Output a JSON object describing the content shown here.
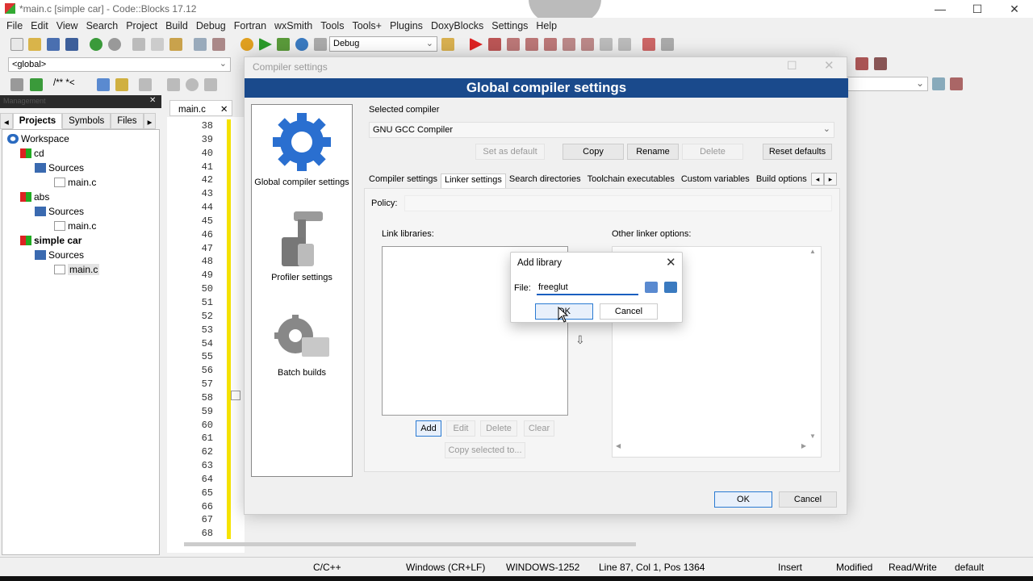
{
  "window": {
    "title": "*main.c [simple car] - Code::Blocks 17.12",
    "minimize": "—",
    "maximize": "☐",
    "close": "✕"
  },
  "menu": [
    "File",
    "Edit",
    "View",
    "Search",
    "Project",
    "Build",
    "Debug",
    "Fortran",
    "wxSmith",
    "Tools",
    "Tools+",
    "Plugins",
    "DoxyBlocks",
    "Settings",
    "Help"
  ],
  "toolbar": {
    "build_target": "Debug",
    "scope": "<global>",
    "comment_tags": "/** *<"
  },
  "management": {
    "header": "Management",
    "tabs": [
      "Projects",
      "Symbols",
      "Files"
    ],
    "tree": [
      {
        "label": "Workspace",
        "level": 0,
        "icon": "workspace-icon"
      },
      {
        "label": "cd",
        "level": 1,
        "icon": "project-icon"
      },
      {
        "label": "Sources",
        "level": 2,
        "icon": "folder-icon"
      },
      {
        "label": "main.c",
        "level": 3,
        "icon": "file-icon"
      },
      {
        "label": "abs",
        "level": 1,
        "icon": "project-icon"
      },
      {
        "label": "Sources",
        "level": 2,
        "icon": "folder-icon"
      },
      {
        "label": "main.c",
        "level": 3,
        "icon": "file-icon"
      },
      {
        "label": "simple car",
        "level": 1,
        "icon": "project-icon",
        "bold": true
      },
      {
        "label": "Sources",
        "level": 2,
        "icon": "folder-icon"
      },
      {
        "label": "main.c",
        "level": 3,
        "icon": "file-icon",
        "selected": true
      }
    ]
  },
  "editor": {
    "tab": "main.c",
    "tab_close": "✕",
    "line_numbers": [
      "38",
      "39",
      "40",
      "41",
      "42",
      "43",
      "44",
      "45",
      "46",
      "47",
      "48",
      "49",
      "50",
      "51",
      "52",
      "53",
      "54",
      "55",
      "56",
      "57",
      "58",
      "59",
      "60",
      "61",
      "62",
      "63",
      "64",
      "65",
      "66",
      "67",
      "68"
    ]
  },
  "status": {
    "language": "C/C++",
    "eol": "Windows (CR+LF)",
    "encoding": "WINDOWS-1252",
    "position": "Line 87, Col 1, Pos 1364",
    "mode": "Insert",
    "modified": "Modified",
    "access": "Read/Write",
    "profile": "default"
  },
  "compiler_dialog": {
    "title": "Compiler settings",
    "banner": "Global compiler settings",
    "categories": [
      {
        "label": "Global compiler settings",
        "icon": "gear-icon"
      },
      {
        "label": "Profiler settings",
        "icon": "profiler-icon"
      },
      {
        "label": "Batch builds",
        "icon": "batch-gear-icon"
      }
    ],
    "selected_compiler_label": "Selected compiler",
    "selected_compiler": "GNU GCC Compiler",
    "buttons": {
      "set_default": "Set as default",
      "copy": "Copy",
      "rename": "Rename",
      "delete": "Delete",
      "reset": "Reset defaults"
    },
    "tabs": [
      "Compiler settings",
      "Linker settings",
      "Search directories",
      "Toolchain executables",
      "Custom variables",
      "Build options"
    ],
    "active_tab": "Linker settings",
    "policy_label": "Policy:",
    "link_libraries_label": "Link libraries:",
    "other_linker_label": "Other linker options:",
    "lib_buttons": {
      "add": "Add",
      "edit": "Edit",
      "delete": "Delete",
      "clear": "Clear",
      "copy_selected": "Copy selected to..."
    },
    "ok": "OK",
    "cancel": "Cancel"
  },
  "add_library": {
    "title": "Add library",
    "file_label": "File:",
    "file_value": "freeglut",
    "ok": "OK",
    "cancel": "Cancel",
    "close": "✕"
  }
}
